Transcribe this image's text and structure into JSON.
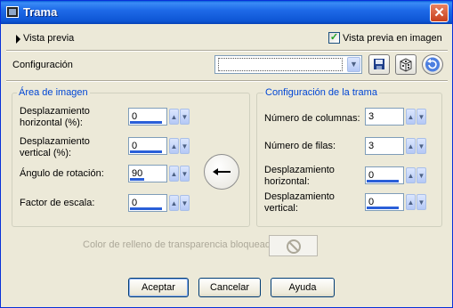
{
  "window": {
    "title": "Trama",
    "close_label": "✕"
  },
  "preview": {
    "toggle_label": "Vista previa",
    "checkbox_label": "Vista previa en imagen",
    "checked": true
  },
  "config": {
    "label": "Configuración",
    "value": ""
  },
  "image_area": {
    "title": "Área de imagen",
    "fields": [
      {
        "label_line1": "Desplazamiento",
        "label_line2": "horizontal (%):",
        "value": "0"
      },
      {
        "label_line1": "Desplazamiento",
        "label_line2": "vertical (%):",
        "value": "0"
      },
      {
        "label": "Ángulo de rotación:",
        "value": "90"
      },
      {
        "label": "Factor de escala:",
        "value": "0"
      }
    ]
  },
  "grid_config": {
    "title": "Configuración de la trama",
    "fields": [
      {
        "label": "Número de columnas:",
        "value": "3"
      },
      {
        "label": "Número de filas:",
        "value": "3"
      },
      {
        "label_line1": "Desplazamiento",
        "label_line2": "horizontal:",
        "value": "0"
      },
      {
        "label_line1": "Desplazamiento",
        "label_line2": "vertical:",
        "value": "0"
      }
    ]
  },
  "fill_color": {
    "label": "Color de relleno de transparencia bloqueado:"
  },
  "buttons": {
    "accept": "Aceptar",
    "cancel": "Cancelar",
    "help": "Ayuda"
  },
  "icons": {
    "save": "save-icon",
    "random": "dice-icon",
    "reset": "reset-icon",
    "dial": "rotation-dial-icon",
    "no_color": "no-color-icon"
  },
  "colors": {
    "titlebar": "#0a5fd8",
    "accent": "#0046d5",
    "face": "#ece9d8"
  }
}
